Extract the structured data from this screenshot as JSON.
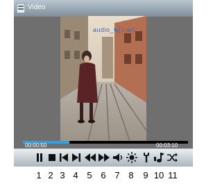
{
  "window": {
    "title": "Video"
  },
  "player": {
    "filename": "audio_wj i avi",
    "elapsed": "00:00:50",
    "duration": "00:03:10",
    "progress_fraction": 0.28
  },
  "controls": [
    {
      "name": "pause",
      "number": "1"
    },
    {
      "name": "stop",
      "number": "2"
    },
    {
      "name": "previous",
      "number": "3"
    },
    {
      "name": "next",
      "number": "4"
    },
    {
      "name": "rewind",
      "number": "5"
    },
    {
      "name": "fast-forward",
      "number": "6"
    },
    {
      "name": "volume",
      "number": "7"
    },
    {
      "name": "brightness",
      "number": "8"
    },
    {
      "name": "settings",
      "number": "9"
    },
    {
      "name": "music",
      "number": "10"
    },
    {
      "name": "shuffle",
      "number": "11"
    }
  ],
  "colors": {
    "accent": "#2f9fe6",
    "filename": "#2a63ff"
  }
}
